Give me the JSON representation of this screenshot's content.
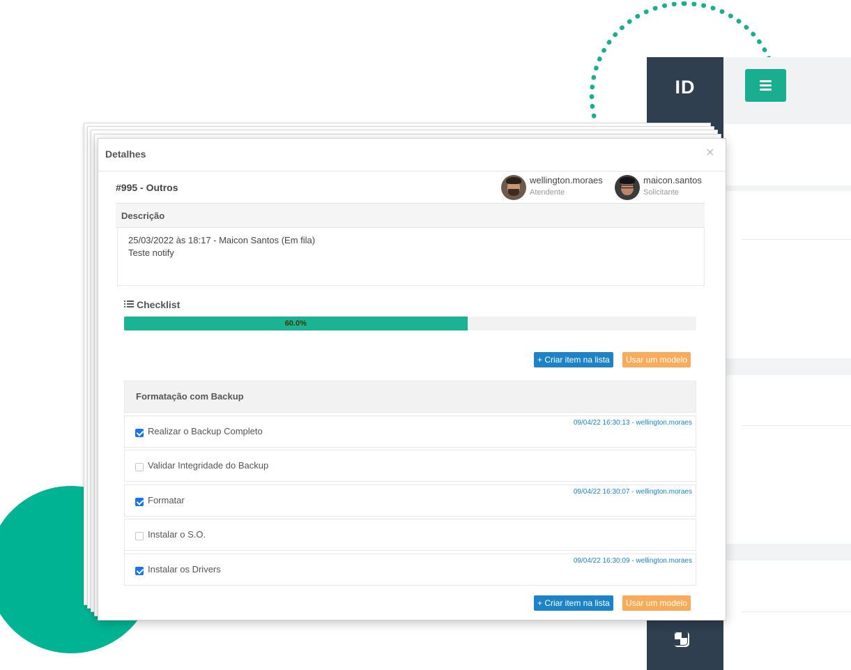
{
  "app": {
    "logo": "ID"
  },
  "modal": {
    "title": "Detalhes",
    "close_icon": "×",
    "ticket_title": "#995 - Outros",
    "users": [
      {
        "name": "wellington.moraes",
        "role": "Atendente"
      },
      {
        "name": "maicon.santos",
        "role": "Solicitante"
      }
    ],
    "description": {
      "label": "Descrição",
      "line1": "25/03/2022 às 18:17 - Maicon Santos (Em fila)",
      "line2": "Teste notify"
    },
    "checklist": {
      "heading": "Checklist",
      "progress_percent": 60,
      "progress_label": "60.0%",
      "add_item_label": "+ Criar item na lista",
      "use_template_label": "Usar um modelo",
      "group_title": "Formatação com Backup",
      "items": [
        {
          "label": "Realizar o Backup Completo",
          "checked": true,
          "meta": "09/04/22 16:30:13 - wellington.moraes"
        },
        {
          "label": "Validar Integridade do Backup",
          "checked": false,
          "meta": ""
        },
        {
          "label": "Formatar",
          "checked": true,
          "meta": "09/04/22 16:30:07 - wellington.moraes"
        },
        {
          "label": "Instalar o S.O.",
          "checked": false,
          "meta": ""
        },
        {
          "label": "Instalar os Drivers",
          "checked": true,
          "meta": "09/04/22 16:30:09 - wellington.moraes"
        }
      ]
    }
  },
  "colors": {
    "accent_green": "#1bb394",
    "sidebar_dark": "#2f3f4f",
    "button_blue": "#1c84c6",
    "button_orange": "#f8ac59",
    "checkbox_blue": "#1a73e8"
  }
}
